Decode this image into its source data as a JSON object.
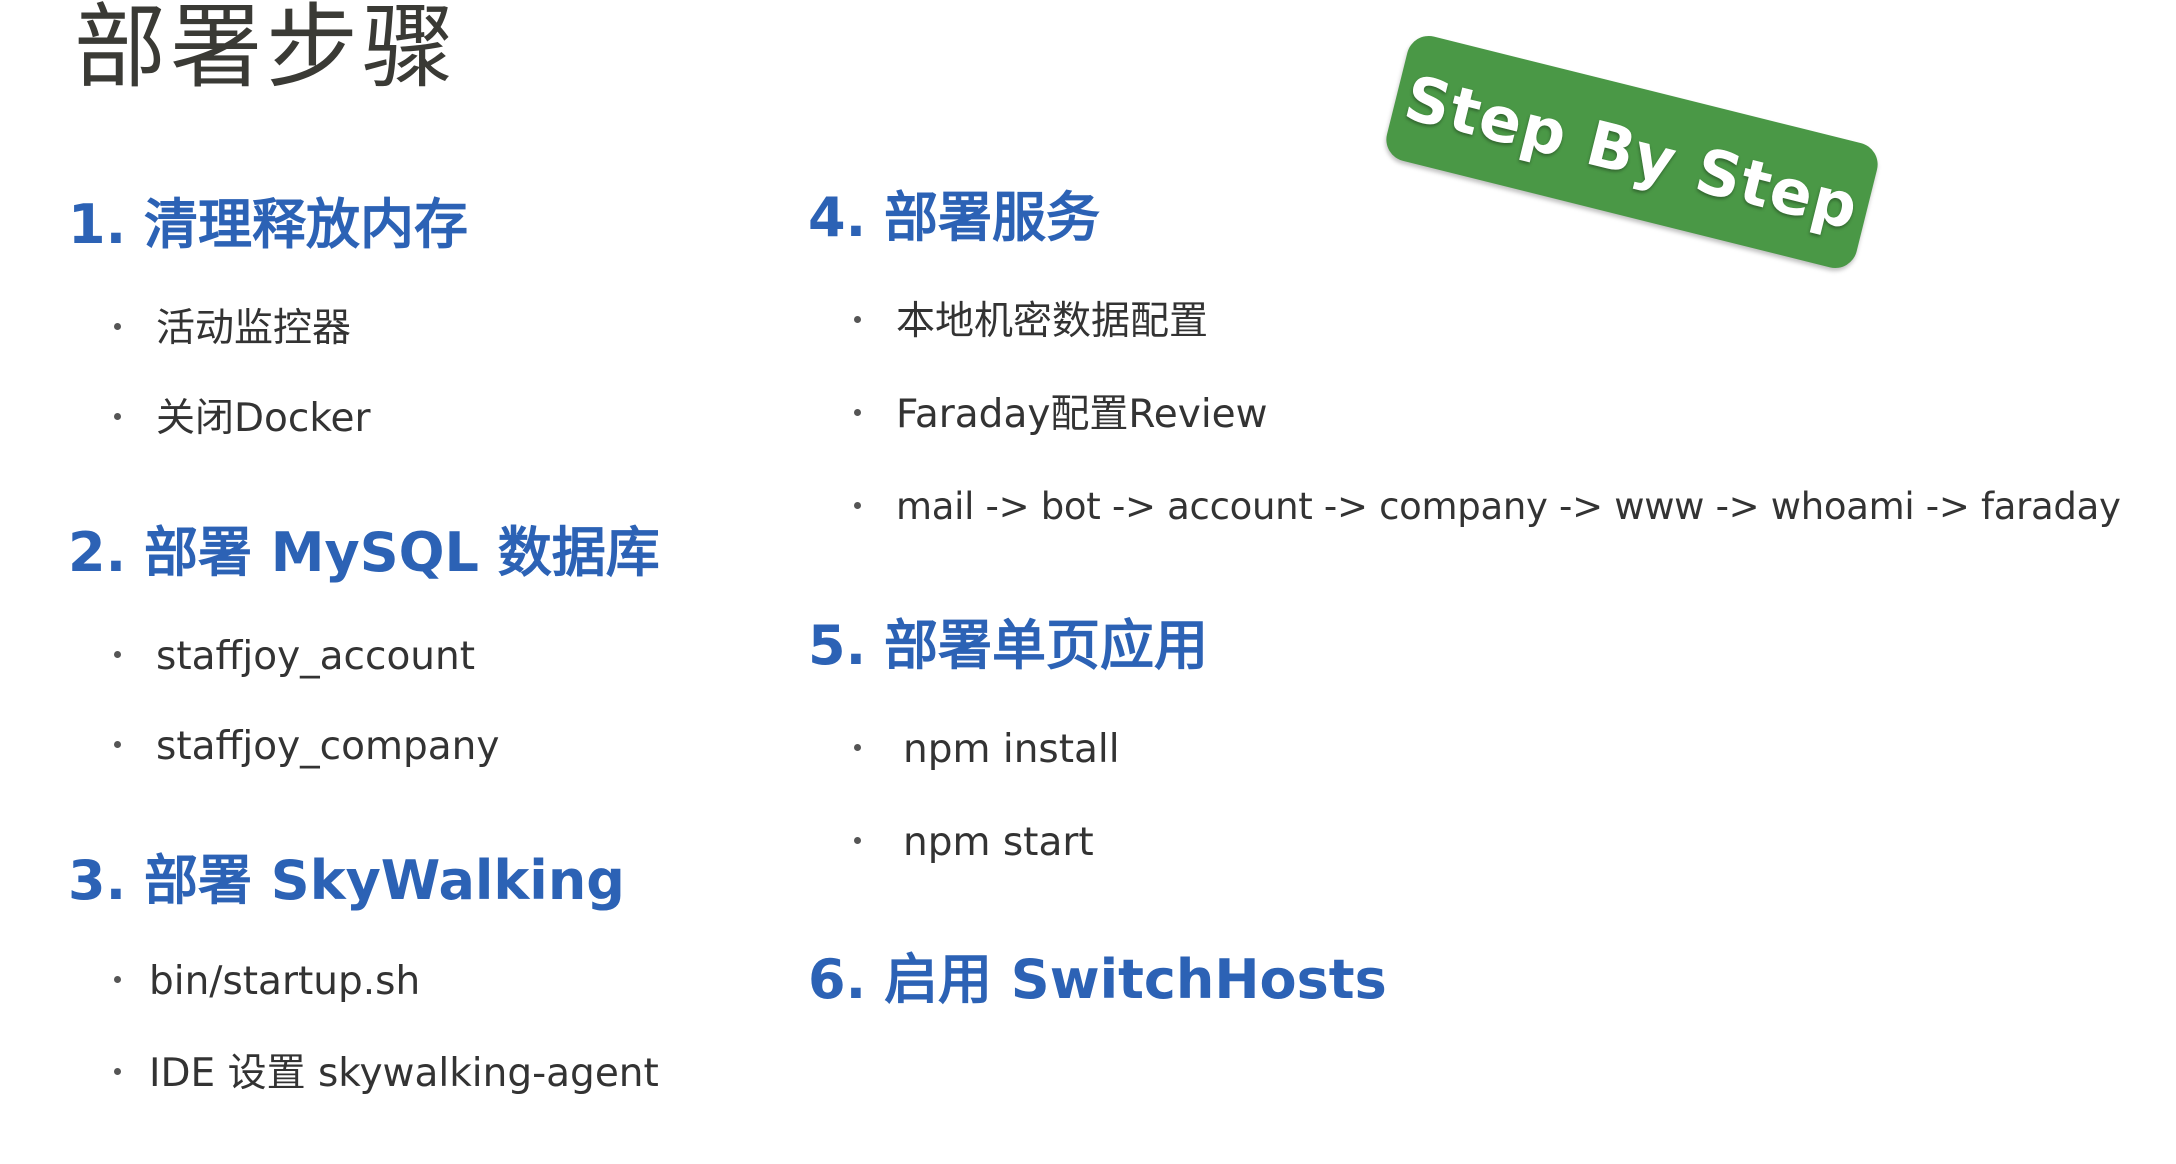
{
  "title": "部署步骤",
  "badge": "Step By Step",
  "left_sections": [
    {
      "number": "1.",
      "title": "清理释放内存",
      "items": [
        "活动监控器",
        "关闭Docker"
      ]
    },
    {
      "number": "2.",
      "title": "部署 MySQL 数据库",
      "items": [
        "staffjoy_account",
        "staffjoy_company"
      ]
    },
    {
      "number": "3.",
      "title": "部署 SkyWalking",
      "items": [
        "bin/startup.sh",
        "IDE 设置 skywalking-agent"
      ]
    }
  ],
  "right_sections": [
    {
      "number": "4.",
      "title": "部署服务",
      "items": [
        "本地机密数据配置",
        "Faraday配置Review",
        "mail -> bot -> account -> company -> www -> whoami -> faraday"
      ]
    },
    {
      "number": "5.",
      "title": "部署单页应用",
      "items": [
        "npm install",
        "npm start"
      ]
    },
    {
      "number": "6.",
      "title": "启用 SwitchHosts",
      "items": []
    }
  ],
  "colors": {
    "heading": "#2c62b5",
    "badge": "#4a9846",
    "title": "#3a3a35"
  }
}
